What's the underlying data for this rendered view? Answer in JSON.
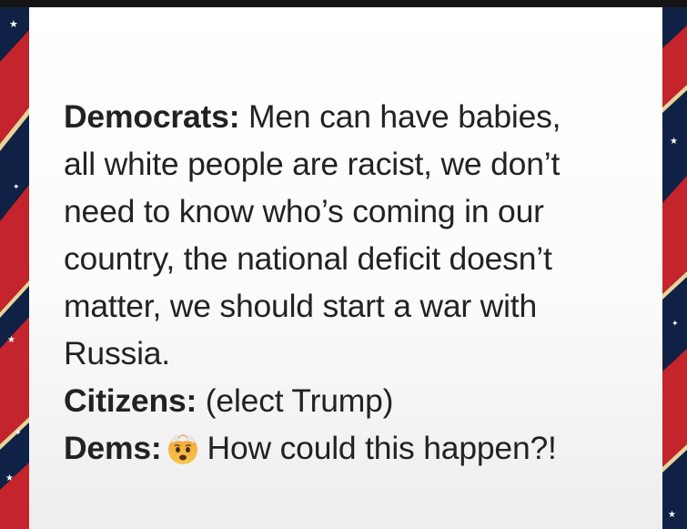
{
  "post": {
    "line1": {
      "speaker": "Democrats:",
      "text": " Men can have babies,"
    },
    "line2": "all white people are racist, we don’t",
    "line3": "need to know who’s coming in our",
    "line4": "country, the national deficit doesn’t",
    "line5": "matter, we should start a war with",
    "line6": "Russia.",
    "line7": {
      "speaker": "Citizens:",
      "text": " (elect Trump)"
    },
    "line8": {
      "speaker": "Dems:",
      "emoji": "exploding-head-emoji",
      "text": "How could this happen?!"
    }
  },
  "colors": {
    "background_navy": "#0f2145",
    "stripe_red": "#c4242b",
    "stripe_gold": "#e8d49a",
    "text": "#222222"
  }
}
